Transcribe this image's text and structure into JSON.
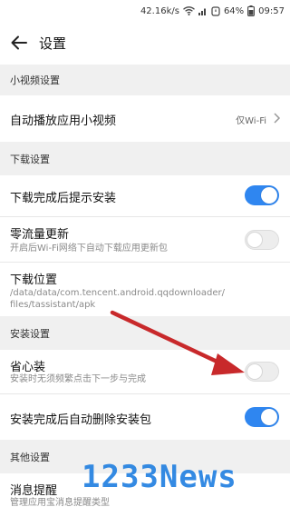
{
  "status_bar": {
    "network_speed": "42.16k/s",
    "battery": "64%",
    "time": "09:57",
    "icons": [
      "wifi-icon",
      "signal-icon",
      "alarm-icon",
      "battery-icon"
    ]
  },
  "header": {
    "back_icon": "arrow-left-icon",
    "title": "设置"
  },
  "sections": {
    "short_video": "小视频设置",
    "download": "下载设置",
    "install": "安装设置",
    "other": "其他设置"
  },
  "rows": {
    "autoplay": {
      "title": "自动播放应用小视频",
      "value": "仅Wi-Fi"
    },
    "install_prompt": {
      "title": "下载完成后提示安装",
      "enabled": true
    },
    "zero_traffic": {
      "title": "零流量更新",
      "subtitle": "开启后Wi-Fi网络下自动下载应用更新包",
      "enabled": false
    },
    "download_location": {
      "title": "下载位置",
      "path_line1": "/data/data/com.tencent.android.qqdownloader/",
      "path_line2": "files/tassistant/apk"
    },
    "worry_free": {
      "title": "省心装",
      "subtitle": "安装时无须频繁点击下一步与完成",
      "enabled": false
    },
    "auto_delete": {
      "title": "安装完成后自动删除安装包",
      "enabled": true
    },
    "message_reminder": {
      "title": "消息提醒",
      "subtitle": "管理应用宝消息提醒类型"
    }
  },
  "colors": {
    "toggle_on": "#2f86f0",
    "annotation_arrow": "#c8292b",
    "watermark": "#1f7ee0"
  },
  "watermark": {
    "text": "1233News"
  }
}
